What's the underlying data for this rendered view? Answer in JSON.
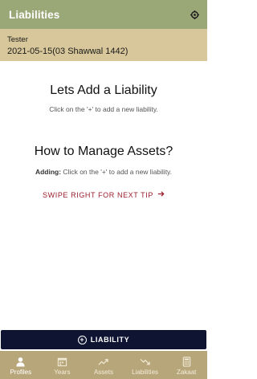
{
  "appbar": {
    "title": "Liabilities",
    "menu_icon": "settings-icon"
  },
  "user": {
    "name": "Tester",
    "date": "2021-05-15(03 Shawwal 1442)"
  },
  "content": {
    "heading1": "Lets Add a Liability",
    "text1": "Click on the '+' to add a new liability.",
    "heading2": "How to Manage Assets?",
    "text2_bold": "Adding:",
    "text2": "Click on the '+' to add a new liability.",
    "tip": "SWIPE RIGHT FOR NEXT TIP",
    "tip_icon": "arrow-right-icon"
  },
  "action": {
    "label": "LIABILITY",
    "icon": "add-circle-icon"
  },
  "nav": {
    "active": "Profiles",
    "items": [
      {
        "label": "Profiles",
        "icon": "person-icon"
      },
      {
        "label": "Years",
        "icon": "calendar-icon"
      },
      {
        "label": "Assets",
        "icon": "trending-up-icon"
      },
      {
        "label": "Liabilities",
        "icon": "trending-down-icon"
      },
      {
        "label": "Zakaat",
        "icon": "calculator-icon"
      }
    ]
  },
  "colors": {
    "appbar": "#9aa777",
    "userbar": "#d8c79a",
    "button": "#0f1433",
    "tip": "#9b1c2c",
    "bottomnav": "#b8a67b"
  }
}
